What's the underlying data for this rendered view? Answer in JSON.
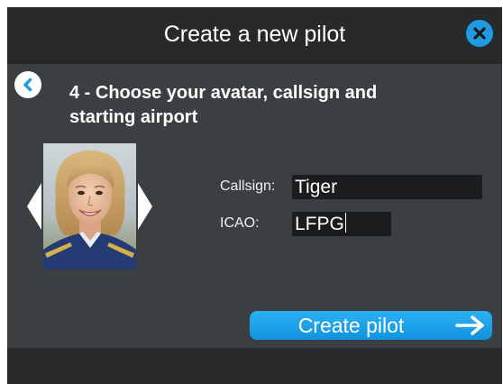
{
  "dialog": {
    "title": "Create a new pilot"
  },
  "step": {
    "title": "4 - Choose your avatar, callsign and starting airport"
  },
  "form": {
    "callsign_label": "Callsign:",
    "callsign_value": "Tiger",
    "icao_label": "ICAO:",
    "icao_value": "LFPG"
  },
  "actions": {
    "create_label": "Create pilot"
  },
  "icons": {
    "close": "close-x-icon",
    "back": "chevron-left-icon",
    "prev_avatar": "triangle-left-icon",
    "next_avatar": "triangle-right-icon",
    "create_arrow": "arrow-right-icon"
  },
  "colors": {
    "accent": "#1f9ae0",
    "button_gradient_top": "#2bb1f2",
    "button_gradient_bottom": "#1192de",
    "panel": "#3c3f42",
    "window": "#27292b"
  }
}
